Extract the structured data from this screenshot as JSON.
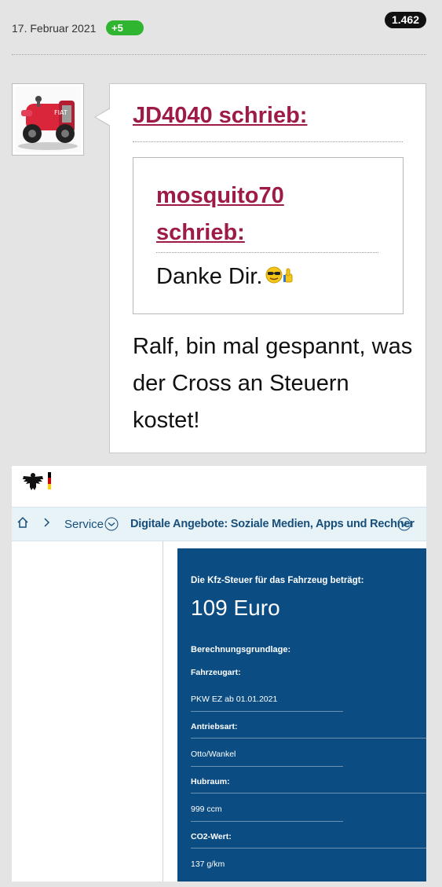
{
  "post_header": {
    "date": "17. Februar 2021",
    "reaction_badge": "+5",
    "post_count": "1.462"
  },
  "avatar": {
    "icon": "avatar-red-fiat-race-car",
    "text": "FIAT"
  },
  "post": {
    "outer_quote_author": "JD4040 schrieb:",
    "inner_quote_author": "mosquito70 schrieb:",
    "inner_quote_text": "Danke Dir.",
    "inner_quote_emoji": "cool-thumbs-up-emoji",
    "body_text": "Ralf, bin mal gespannt, was der Cross an Steuern kostet!",
    "link_color": "#9e1b46"
  },
  "attached_screenshot": {
    "logo_icon": "federal-eagle-icon",
    "flag_colors": [
      "#000000",
      "#dd0000",
      "#ffce00"
    ],
    "breadcrumb": {
      "home_icon": "home-icon",
      "service_label": "Service",
      "current_label": "Digitale Angebote: Soziale Medien, Apps und Rechner"
    },
    "result": {
      "heading": "Die Kfz-Steuer für das Fahrzeug beträgt:",
      "amount": "109 Euro",
      "basis_label": "Berechnungsgrundlage:",
      "rows": [
        {
          "label": "Fahrzeugart:",
          "value": "PKW EZ ab 01.01.2021"
        },
        {
          "label": "Antriebsart:",
          "value": "Otto/Wankel"
        },
        {
          "label": "Hubraum:",
          "value": "999 ccm"
        },
        {
          "label": "CO2-Wert:",
          "value": "137 g/km"
        }
      ],
      "panel_color": "#0b4d82"
    }
  }
}
